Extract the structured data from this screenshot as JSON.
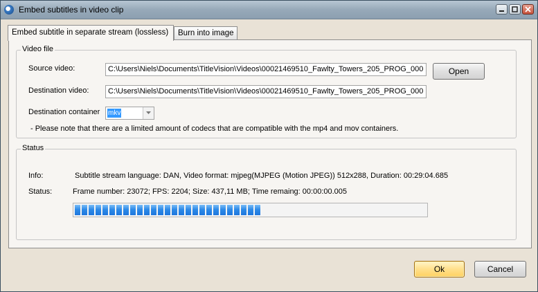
{
  "window": {
    "title": "Embed subtitles in video clip"
  },
  "tabs": [
    {
      "label": "Embed subtitle in separate stream (lossless)",
      "active": true
    },
    {
      "label": "Burn into image",
      "active": false
    }
  ],
  "video_file": {
    "group_title": "Video file",
    "source_label": "Source video:",
    "source_value": "C:\\Users\\Niels\\Documents\\TitleVision\\Videos\\00021469510_Fawlty_Towers_205_PROG_000",
    "open_button": "Open",
    "destination_label": "Destination video:",
    "destination_value": "C:\\Users\\Niels\\Documents\\TitleVision\\Videos\\00021469510_Fawlty_Towers_205_PROG_000",
    "container_label": "Destination container",
    "container_value": "mkv",
    "note": "- Please note that there are a limited amount of codecs that are compatible with the mp4 and mov containers."
  },
  "status": {
    "group_title": "Status",
    "info_label": "Info:",
    "info_value": "Subtitle stream language: DAN, Video format: mjpeg(MJPEG (Motion JPEG)) 512x288, Duration: 00:29:04.685",
    "status_label": "Status:",
    "status_value": "Frame number: 23072; FPS: 2204; Size: 437,11 MB; Time remaing: 00:00:00.005",
    "progress_percent": 53
  },
  "buttons": {
    "ok": "Ok",
    "cancel": "Cancel"
  },
  "colors": {
    "progress": "#2d8ae8",
    "default_button": "#ffe08c",
    "titlebar": "#97a9b9"
  }
}
